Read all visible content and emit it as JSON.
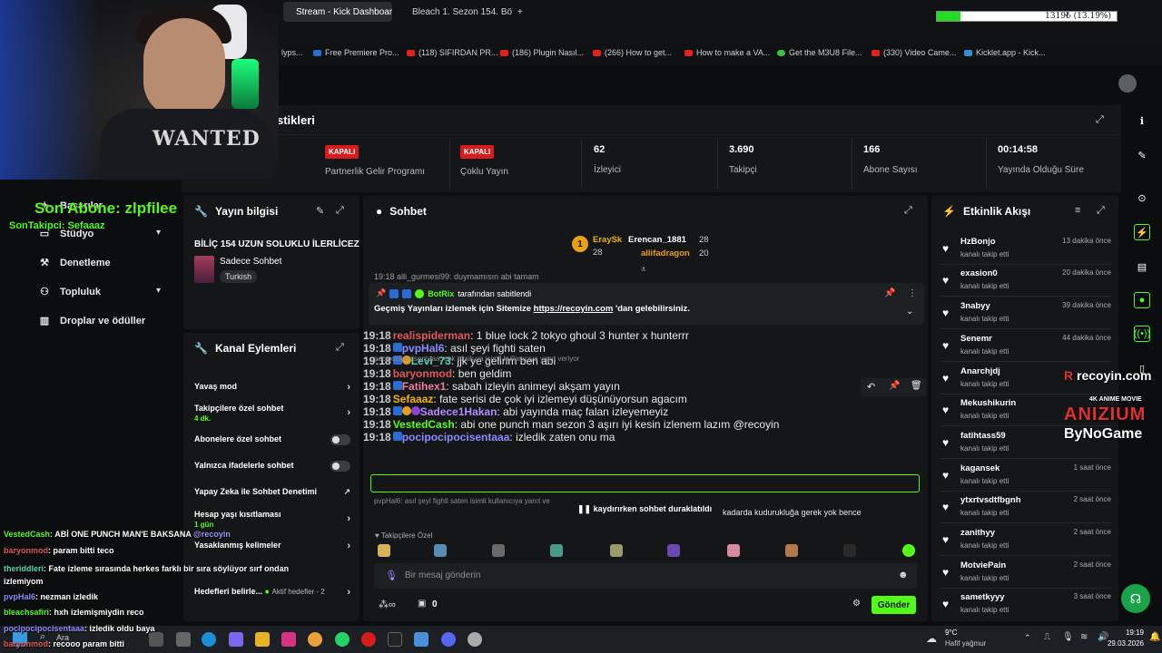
{
  "browser": {
    "tabs": [
      {
        "label": "Stream - Kick Dashboard",
        "active": true
      },
      {
        "label": "Bleach 1. Sezon 154. Bölüm",
        "active": false
      }
    ],
    "new_tab": "+",
    "memory_text": "1319₺ (13.19%)",
    "memory_percent": 13.19,
    "bookmarks": [
      "lyps...",
      "Free Premiere Pro...",
      "(118) SIFIRDAN PR...",
      "(186) Plugin Nasıl...",
      "(266) How to get...",
      "How to make a VA...",
      "Get the M3U8 File...",
      "(330) Video Came...",
      "Kicklet.app - Kick..."
    ]
  },
  "header": {
    "title_partial": "stikleri"
  },
  "stats": [
    {
      "badge": "KAPALI",
      "label": "Partnerlik Gelir Programı"
    },
    {
      "badge": "KAPALI",
      "label": "Çoklu Yayın"
    },
    {
      "value": "62",
      "label": "İzleyici"
    },
    {
      "value": "3.690",
      "label": "Takipçi"
    },
    {
      "value": "166",
      "label": "Abone Sayısı"
    },
    {
      "value": "00:14:58",
      "label": "Yayında Olduğu Süre"
    }
  ],
  "nav": {
    "items": [
      "Başarılar",
      "Stüdyo",
      "Denetleme",
      "Topluluk",
      "Droplar ve ödüller"
    ]
  },
  "stream_info": {
    "title": "Yayın bilgisi",
    "stream_title": "BİLİÇ 154 UZUN SOLUKLU İLERLİCEZ",
    "category": "Sadece Sohbet",
    "language": "Turkish"
  },
  "channel_actions": {
    "title": "Kanal Eylemleri",
    "slow_mode": "Yavaş mod",
    "followers_only": "Takipçilere özel sohbet",
    "followers_only_sub": "4 dk.",
    "subscribers_only": "Abonelere özel sohbet",
    "emotes_only": "Yalnızca ifadelerle sohbet",
    "ai_moderation": "Yapay Zeka ile Sohbet Denetimi",
    "account_age": "Hesap yaşı kısıtlaması",
    "account_age_sub": "1 gün",
    "banned_words": "Yasaklanmış kelimeler",
    "goals": "Hedefleri belirle...",
    "goals_status": "Aktif hedefler - 2"
  },
  "chat": {
    "title": "Sohbet",
    "leaders": [
      {
        "rank": "1",
        "name": "EraySk",
        "count": "28"
      },
      {
        "name": "Erencan_1881",
        "count": "28"
      },
      {
        "name": "allifadragon",
        "count": "20"
      }
    ],
    "top_partial": "19:18  alli_gurmesi99: duymamısın abi tamam",
    "pinned_by": "BotRix",
    "pinned_by_suffix": "tarafından sabitlendi",
    "pinned_text": "Geçmiş Yayınları izlemek için Sitemize",
    "pinned_link": "https://recoyin.com",
    "pinned_tail": "'dan gelebilirsiniz.",
    "messages": [
      {
        "ts": "19:18",
        "user": "realispiderman",
        "text": ": 1 blue lock 2 tokyo ghoul 3 hunter x hunterrr",
        "color": "#e05858"
      },
      {
        "reply": "pocipocipocisentaaa: çok eksik ya isimli kullanıcıya yanıt veriyor"
      },
      {
        "ts": "19:18",
        "user": "pvpHal6",
        "text": ": asıl şeyi fighti saten",
        "color": "#8c8cff"
      },
      {
        "ts": "19:18",
        "user": "Levi_73",
        "text": ": jjk ye gelirim ben abi",
        "color": "#53d6b4"
      },
      {
        "ts": "19:18",
        "user": "baryonmod",
        "text": ": ben geldim",
        "color": "#e05858"
      },
      {
        "ts": "19:18",
        "user": "Fatihex1",
        "text": ": sabah izleyin animeyi akşam yayın",
        "color": "#f07c9c"
      },
      {
        "ts": "19:18",
        "user": "Sefaaaz",
        "text": ": fate serisi de çok iyi izlemeyi düşünüyorsun agacım",
        "color": "#f0b400"
      },
      {
        "ts": "19:18",
        "user": "Sadece1Hakan",
        "text": ": abi yayında maç falan izleyemeyiz",
        "color": "#b48cff"
      },
      {
        "ts": "19:18",
        "user": "VestedCash",
        "text": ": abi one punch man sezon 3 aşırı iyi kesin izlenem lazım @recoyin",
        "color": "#53fc18"
      },
      {
        "reply": "pvpHal6: asıl şeyi fighti saten isimli kullanıcıya yanıt ve"
      },
      {
        "ts": "19:18",
        "user": "pocipocipocisentaaa",
        "text": ": izledik zaten onu ma",
        "color": "#8c8cff"
      }
    ],
    "paused_label": "kaydırırken sohbet duraklatıldı",
    "paused_tail": "kadarda kudurukluğa gerek yok bence",
    "followers_only_label": "Takipçilere Özel",
    "input_placeholder": "Bir mesaj gönderin",
    "count": "0",
    "send": "Gönder"
  },
  "activity": {
    "title": "Etkinlik Akışı",
    "items": [
      {
        "name": "HzBonjo",
        "sub": "kanalı takip etti",
        "time": "13 dakika önce"
      },
      {
        "name": "exasion0",
        "sub": "kanalı takip etti",
        "time": "20 dakika önce"
      },
      {
        "name": "3nabyy",
        "sub": "kanalı takip etti",
        "time": "39 dakika önce"
      },
      {
        "name": "Senemr",
        "sub": "kanalı takip etti",
        "time": "44 dakika önce"
      },
      {
        "name": "Anarchjdj",
        "sub": "kanalı takip etti",
        "time": ""
      },
      {
        "name": "Mekushikurin",
        "sub": "kanalı takip etti",
        "time": ""
      },
      {
        "name": "fatihtass59",
        "sub": "kanalı takip etti",
        "time": ""
      },
      {
        "name": "kagansek",
        "sub": "kanalı takip etti",
        "time": "1 saat önce"
      },
      {
        "name": "ytxrtvsdtfbgnh",
        "sub": "kanalı takip etti",
        "time": "2 saat önce"
      },
      {
        "name": "zanithyy",
        "sub": "kanalı takip etti",
        "time": "2 saat önce"
      },
      {
        "name": "MotviePain",
        "sub": "kanalı takip etti",
        "time": "2 saat önce"
      },
      {
        "name": "sametkyyy",
        "sub": "kanalı takip etti",
        "time": "3 saat önce"
      }
    ]
  },
  "overlay": {
    "webcam_shirt": "WANTED",
    "son_abone": "Son Abone: zlpfilee",
    "son_takipci": "SonTakipci: Sefaaaz",
    "recoyin": "recoyin.com",
    "anime_movie": "4K ANIME MOVIE",
    "anizium": "ANIZIUM",
    "bynogame": "ByNoGame",
    "chat_lines": [
      {
        "user": "VestedCash",
        "text": ": ABİ ONE PUNCH MAN'E BAKSANA",
        "tag": "@recoyin"
      },
      {
        "user": "baryonmod",
        "text": ": param bitti teco"
      },
      {
        "user": "theriddleri",
        "text": ": Fate izleme sırasında herkes farklı bir sıra söylüyor sırf ondan izlemiyom"
      },
      {
        "user": "pvpHal6",
        "text": ": nezman izledik"
      },
      {
        "user": "bleachsafiri",
        "text": ": hxh izlemişmiydin reco"
      },
      {
        "user": "pocipocipocisentaaa",
        "text": ": izledik oldu baya"
      },
      {
        "user": "baryonmod",
        "text": ": recooo param bitti"
      }
    ]
  },
  "taskbar": {
    "search": "Ara",
    "weather_temp": "9°C",
    "weather_desc": "Hafif yağmur",
    "time": "19:19",
    "date": "29.03.2026"
  },
  "colors": {
    "accent": "#53fc18",
    "panel": "#141618",
    "danger": "#d71c1c"
  }
}
